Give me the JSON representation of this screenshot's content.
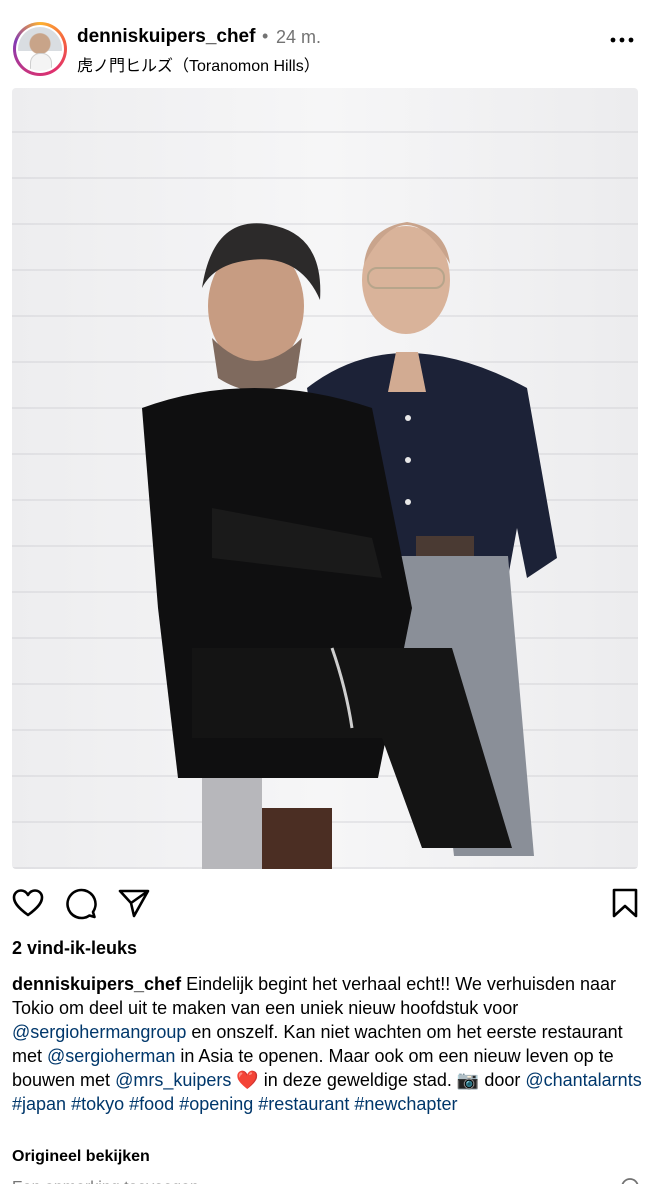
{
  "header": {
    "username": "denniskuipers_chef",
    "separator": "•",
    "time": "24 m.",
    "location": "虎ノ門ヒルズ（Toranomon Hills）",
    "more_icon": "more-horizontal-icon"
  },
  "photo": {
    "description_icon": "post-photo"
  },
  "actions": {
    "like_icon": "heart-icon",
    "comment_icon": "comment-icon",
    "share_icon": "send-icon",
    "save_icon": "bookmark-icon"
  },
  "likes": "2 vind-ik-leuks",
  "caption": {
    "username": "denniskuipers_chef",
    "t1": " Eindelijk begint het verhaal echt!! We verhuisden naar Tokio om deel uit te maken van een uniek nieuw hoofdstuk voor ",
    "m1": "@sergiohermangroup",
    "t2": " en onszelf. Kan niet wachten om het eerste restaurant met ",
    "m2": "@sergioherman",
    "t3": " in Asia te openen. Maar ook om een nieuw leven op te bouwen met ",
    "m3": "@mrs_kuipers",
    "t4": " ❤️ in deze geweldige stad. 📷 door ",
    "m4": "@chantalarnts",
    "h1": "#japan",
    "h2": "#tokyo",
    "h3": "#food",
    "h4": "#opening",
    "h5": "#restaurant",
    "h6": "#newchapter"
  },
  "view_original": "Origineel bekijken",
  "comment": {
    "placeholder": "Een opmerking toevoegen..."
  },
  "colors": {
    "link": "#00376b",
    "muted": "#737373"
  }
}
